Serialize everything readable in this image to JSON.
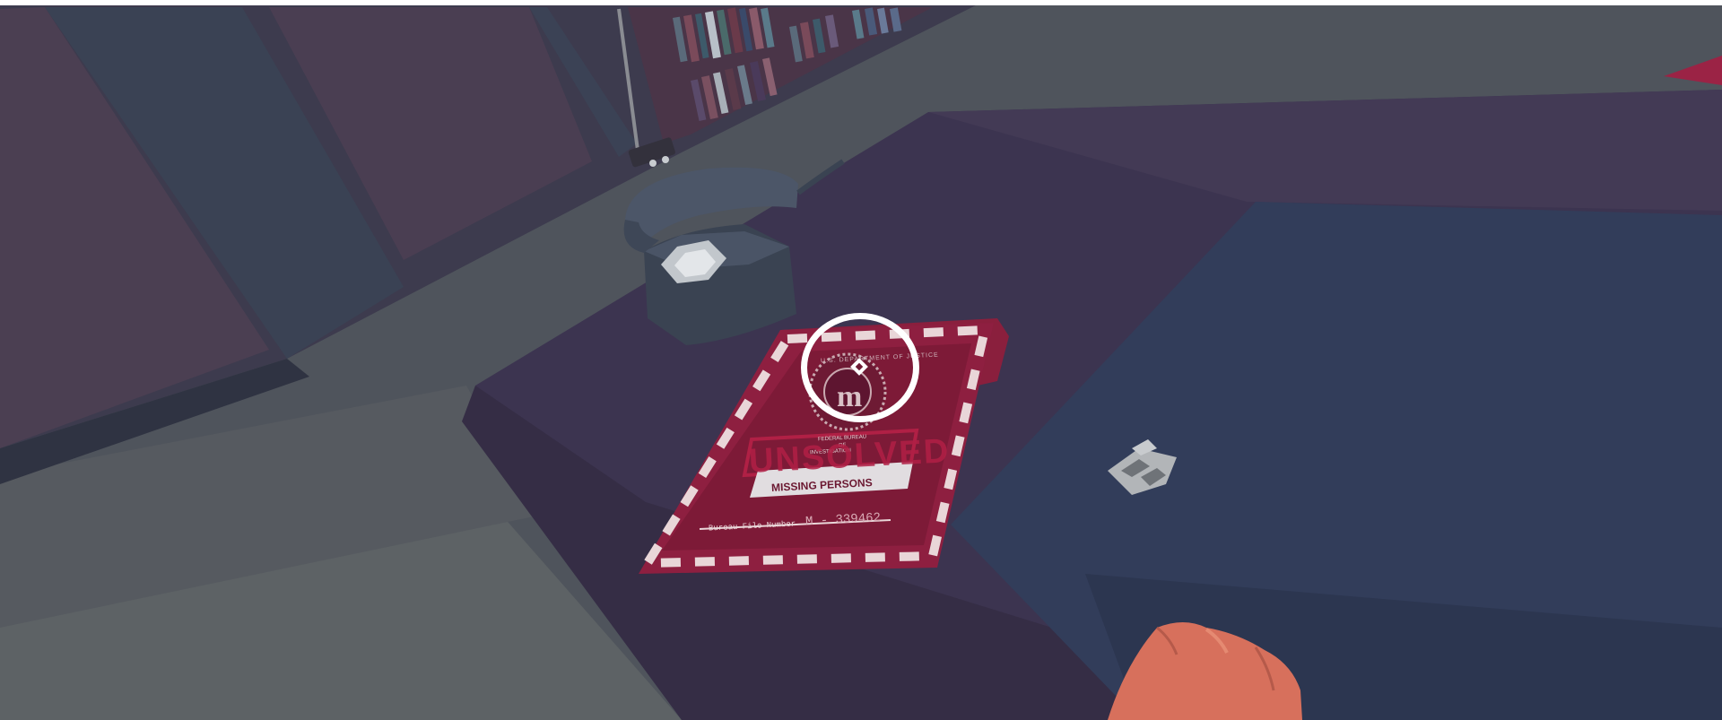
{
  "game": {
    "case_file": {
      "header": "U.S. DEPARTMENT OF JUSTICE",
      "seal_letter": "m",
      "bureau_line1": "FEDERAL BUREAU",
      "bureau_line2": "OF",
      "bureau_line3": "INVESTIGATION",
      "stamp": "UNSOLVED",
      "category": "MISSING PERSONS",
      "file_number_label": "Bureau File Number",
      "file_number": "M - 339462"
    },
    "hud": {
      "crosshair": "interact-reticle"
    }
  }
}
